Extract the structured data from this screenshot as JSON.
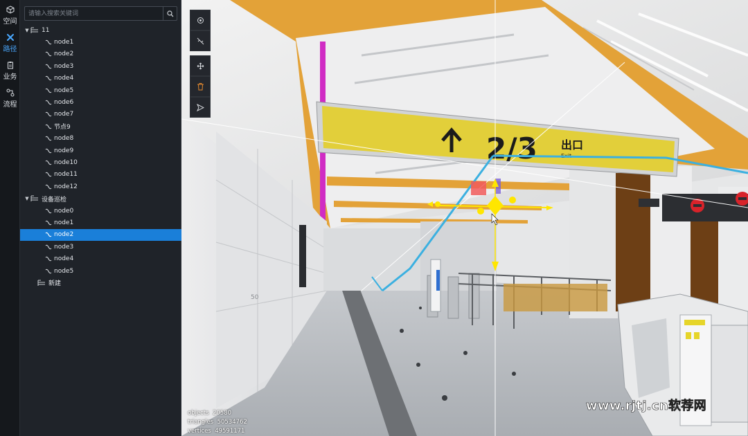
{
  "rail": {
    "items": [
      {
        "label": "空间",
        "icon": "cube-icon",
        "active": false
      },
      {
        "label": "路径",
        "icon": "path-icon",
        "active": true
      },
      {
        "label": "业务",
        "icon": "clipboard-icon",
        "active": false
      },
      {
        "label": "流程",
        "icon": "flow-icon",
        "active": false
      }
    ]
  },
  "search": {
    "placeholder": "请输入搜索关键词",
    "value": "",
    "icon": "search-icon"
  },
  "tree": {
    "groups": [
      {
        "label": "11",
        "expanded": true,
        "nodes": [
          "node1",
          "node2",
          "node3",
          "node4",
          "node5",
          "node6",
          "node7",
          "节点9",
          "node8",
          "node9",
          "node10",
          "node11",
          "node12"
        ]
      },
      {
        "label": "设备巡检",
        "expanded": true,
        "nodes": [
          "node0",
          "node1",
          "node2",
          "node3",
          "node4",
          "node5"
        ],
        "selected_index": 2
      },
      {
        "label": "新建",
        "expanded": false,
        "nodes": []
      }
    ]
  },
  "toolbar": {
    "tools": [
      {
        "icon": "target-icon",
        "name": "locate-tool"
      },
      {
        "icon": "link-off-icon",
        "name": "unlink-tool"
      },
      {
        "icon": "move-icon",
        "name": "move-tool"
      },
      {
        "icon": "trash-icon",
        "name": "delete-tool"
      },
      {
        "icon": "send-icon",
        "name": "send-tool"
      }
    ]
  },
  "scene": {
    "sign_text": "2/3",
    "sign_cn": "出口",
    "sign_en": "Exit",
    "pillar_number": "50",
    "colors": {
      "ceiling_orange": "#e3a238",
      "sign_yellow": "#e2cf3a",
      "path_blue": "#3bb0e0",
      "handle_yellow": "#ffe600",
      "magenta": "#d02cc4"
    }
  },
  "stats": {
    "objects_label": "objects",
    "objects_value": "20580",
    "triangles_label": "triangles",
    "triangles_value": "50534762",
    "vertices_label": "vertices",
    "vertices_value": "49591171"
  },
  "watermark": "www.rjtj.cn软荐网"
}
